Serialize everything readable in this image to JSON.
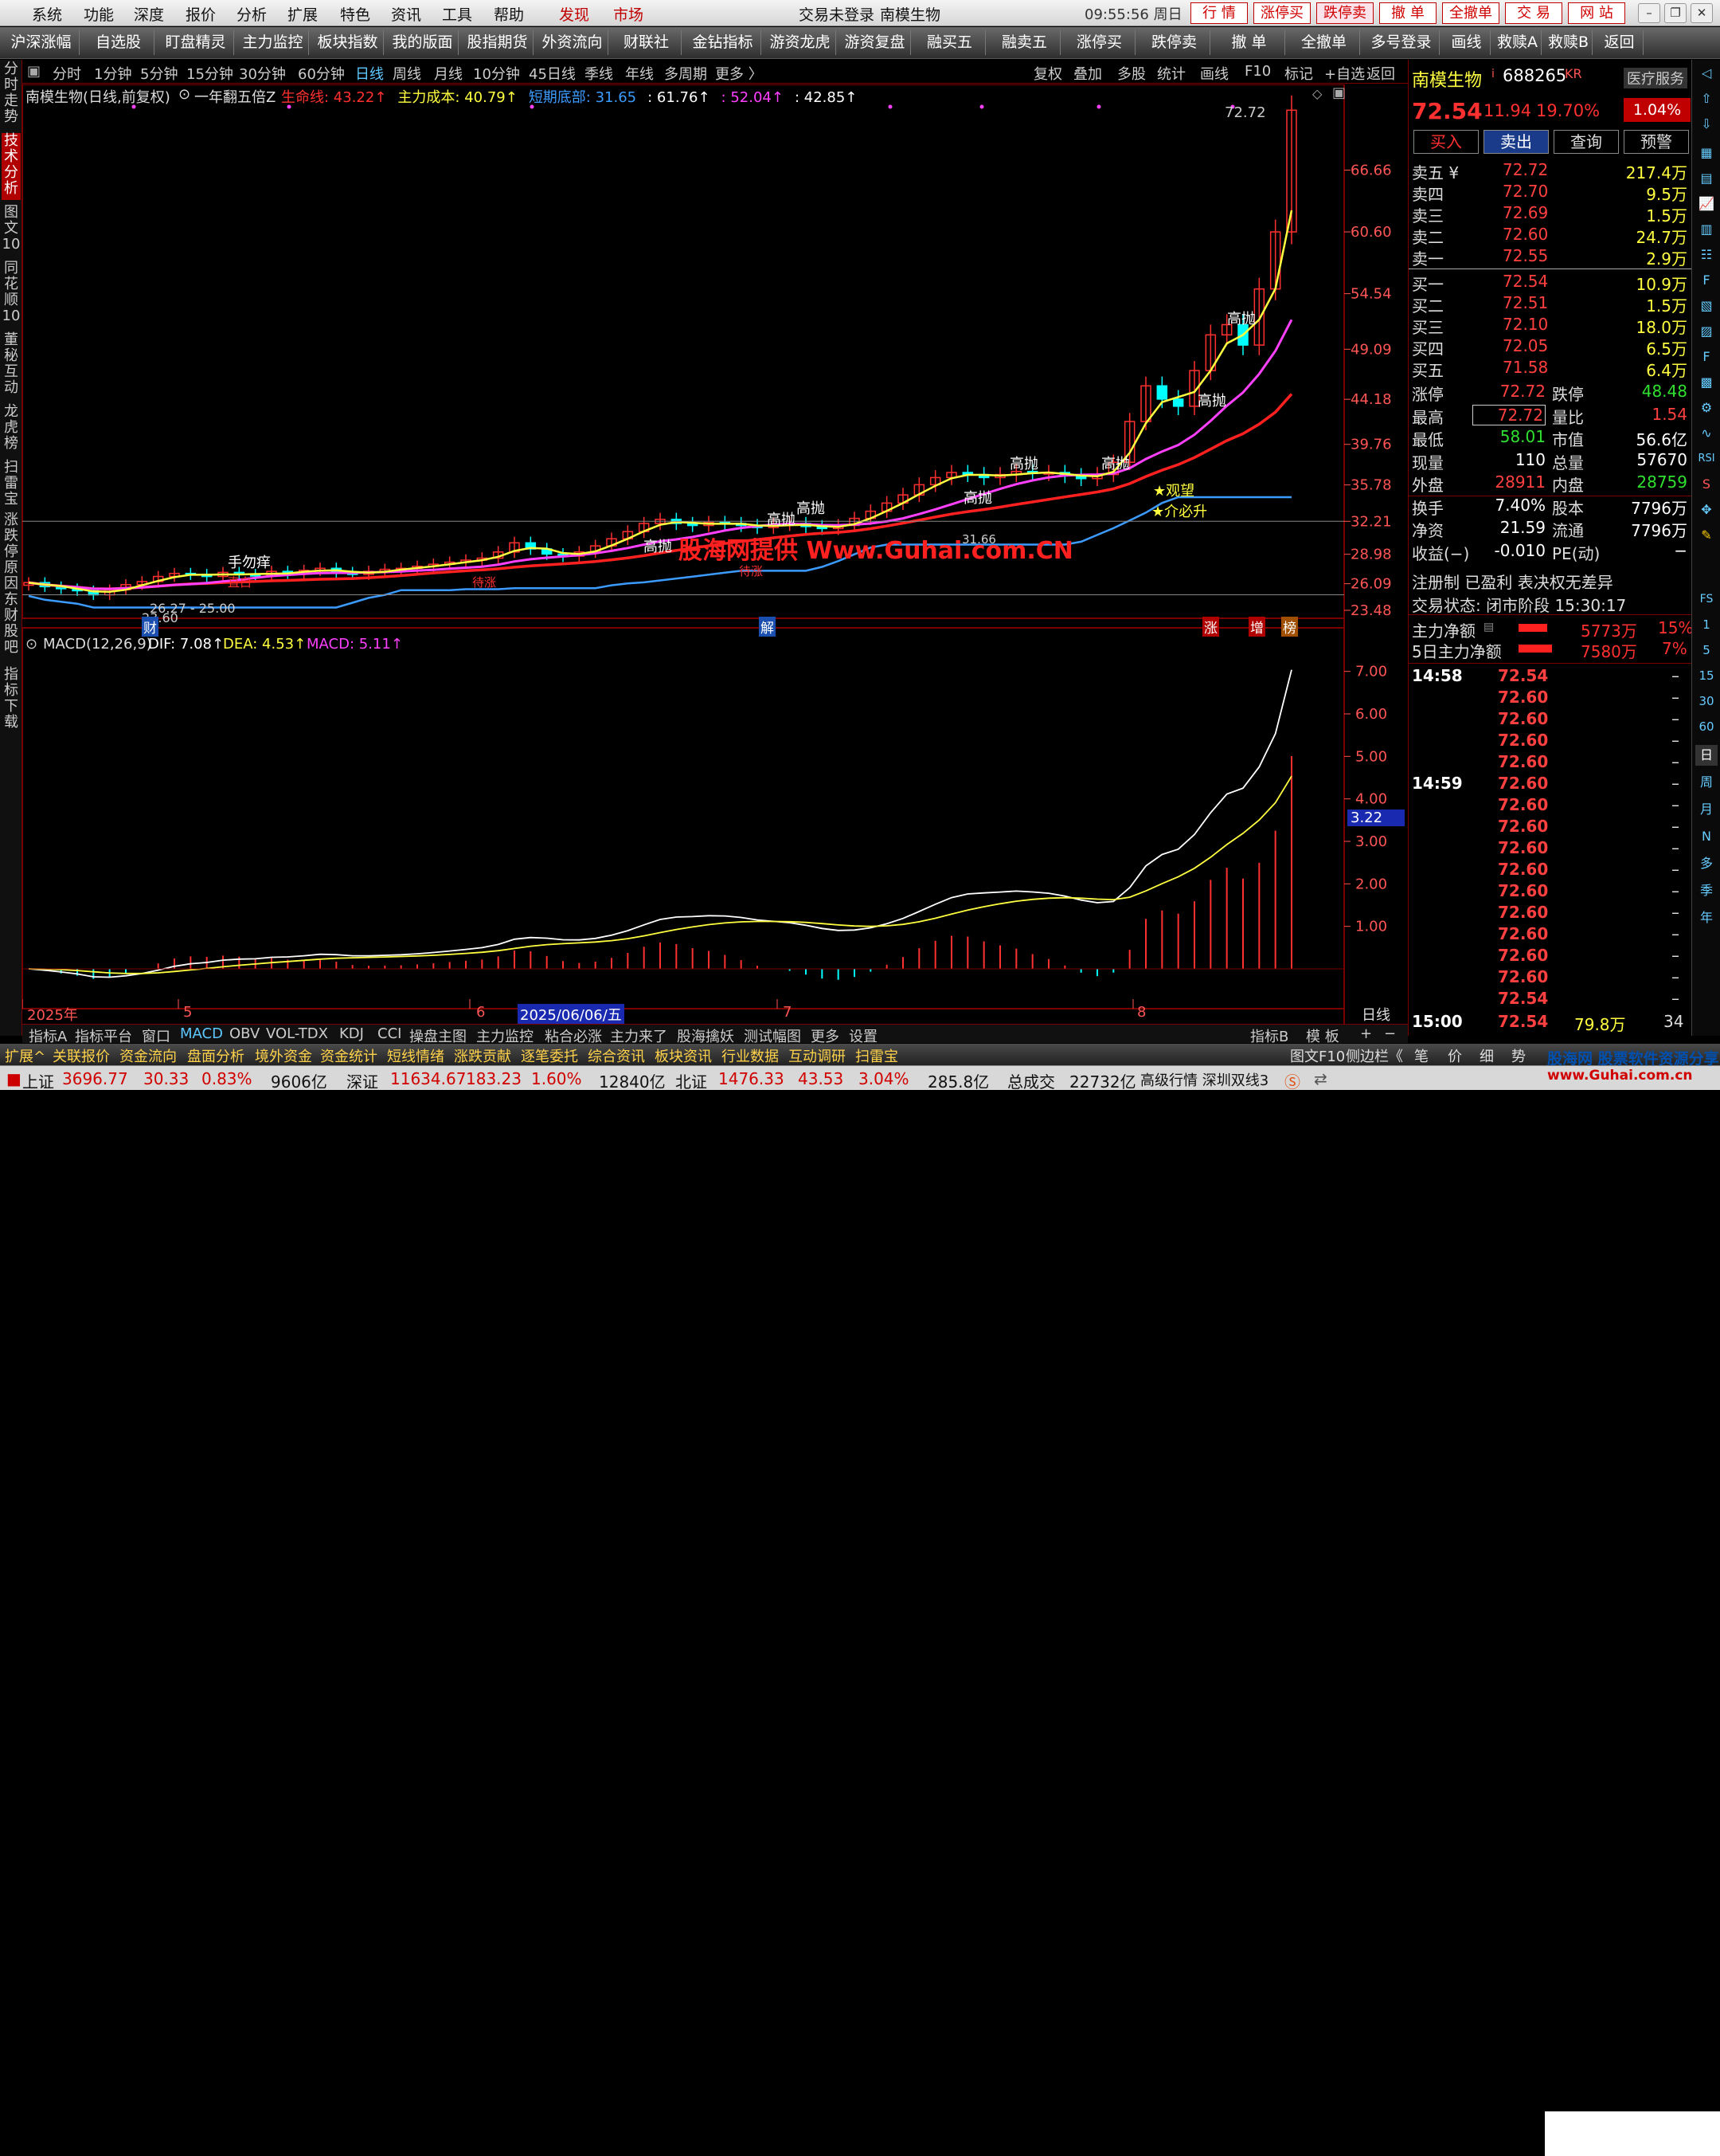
{
  "menubar": {
    "items": [
      "系统",
      "功能",
      "深度",
      "报价",
      "分析",
      "扩展",
      "特色",
      "资讯",
      "工具",
      "帮助"
    ],
    "discover": "发现",
    "market": "市场",
    "login_status": "交易未登录",
    "stock_name": "南模生物",
    "clock": "09:55:56 周日",
    "right_buttons": [
      "行 情",
      "涨停买",
      "跌停卖",
      "撤 单",
      "全撤单",
      "交 易",
      "网 站"
    ]
  },
  "toolbar": {
    "items": [
      "沪深涨幅",
      "自选股",
      "盯盘精灵",
      "主力监控",
      "板块指数",
      "我的版面",
      "股指期货",
      "外资流向",
      "财联社",
      "金钻指标",
      "游资龙虎",
      "游资复盘",
      "融买五",
      "融卖五",
      "涨停买",
      "跌停卖",
      "撤 单",
      "全撤单",
      "多号登录",
      "画线",
      "救赎A",
      "救赎B",
      "返回"
    ]
  },
  "leftnav": {
    "items": [
      {
        "label": "分时走势",
        "active": false
      },
      {
        "label": "技术分析",
        "active": true
      },
      {
        "label": "图文10",
        "active": false
      },
      {
        "label": "同花顺10",
        "active": false
      },
      {
        "label": "董秘互动",
        "active": false
      },
      {
        "label": "龙虎榜",
        "active": false
      },
      {
        "label": "扫雷宝",
        "active": false
      },
      {
        "label": "涨跌停原因",
        "active": false
      },
      {
        "label": "东财股吧",
        "active": false
      },
      {
        "label": "指标下载",
        "active": false
      }
    ]
  },
  "periods": {
    "items": [
      "分时",
      "1分钟",
      "5分钟",
      "15分钟",
      "30分钟",
      "60分钟",
      "日线",
      "周线",
      "月线",
      "10分钟",
      "45日线",
      "季线",
      "年线",
      "多周期",
      "更多 〉"
    ],
    "active": "日线",
    "right": [
      "复权",
      "叠加",
      "多股",
      "统计",
      "画线",
      "F10",
      "标记",
      "+自选",
      "返回"
    ]
  },
  "main_chart": {
    "title": "南模生物(日线,前复权)",
    "indicator": "一年翻五倍Z",
    "legend": [
      {
        "text": "生命线: 43.22↑",
        "color": "#ff3030"
      },
      {
        "text": "主力成本: 40.79↑",
        "color": "#ffff40"
      },
      {
        "text": "短期底部: 31.65",
        "color": "#3c9bff"
      },
      {
        "text": ": 61.76↑",
        "color": "#ffffff"
      },
      {
        "text": ": 52.04↑",
        "color": "#ff40ff"
      },
      {
        "text": ": 42.85↑",
        "color": "#ffffff"
      }
    ],
    "y_ticks": [
      "66.66",
      "60.60",
      "54.54",
      "49.09",
      "44.18",
      "39.76",
      "35.78",
      "32.21",
      "28.98",
      "26.09",
      "23.48"
    ],
    "annotations": {
      "peak": "72.72",
      "low": "23.60",
      "low_range": "26.27 - 25.00",
      "mid": "31.66",
      "high_sell": "高抛",
      "no_scratch": "手勿痒",
      "watch": "★观望",
      "must_rise": "★介必升",
      "bottom": "直白",
      "bottom2": "待涨",
      "bottom3": "待涨"
    },
    "markers": {
      "cai": "财",
      "jie": "解",
      "zhang": "涨",
      "zeng": "增",
      "bang": "榜"
    },
    "watermark": "股海网提供 Www.Guhai.com.CN"
  },
  "macd": {
    "title": "MACD(12,26,9)",
    "dif": "DIF: 7.08↑",
    "dea": "DEA: 4.53↑",
    "macd": "MACD: 5.11↑",
    "y_ticks": [
      "7.00",
      "6.00",
      "5.00",
      "4.00",
      "3.00",
      "2.00",
      "1.00"
    ],
    "current": "3.22",
    "x_labels": [
      "2025年",
      "5",
      "6",
      "2025/06/06/五",
      "7",
      "8"
    ],
    "period_label": "日线"
  },
  "bottom_tabs": {
    "items": [
      "指标A",
      "指标平台",
      "窗口",
      "MACD",
      "OBV",
      "VOL-TDX",
      "KDJ",
      "CCI",
      "操盘主图",
      "主力监控",
      "粘合必涨",
      "主力来了",
      "股海擒妖",
      "测试幅图",
      "更多",
      "设置"
    ],
    "active": "MACD",
    "right": [
      "指标B",
      "模 板",
      "+",
      "−"
    ]
  },
  "ext_bar": {
    "items": [
      "扩展^",
      "关联报价",
      "资金流向",
      "盘面分析",
      "境外资金",
      "资金统计",
      "短线情绪",
      "涨跌贡献",
      "逐笔委托",
      "综合资讯",
      "板块资讯",
      "行业数据",
      "互动调研",
      "扫雷宝"
    ],
    "right": [
      "图文F10",
      "侧边栏《",
      "笔",
      "价",
      "细",
      "势"
    ]
  },
  "status": {
    "sh_label": "上证",
    "sh_value": "3696.77",
    "sh_change": "30.33",
    "sh_pct": "0.83%",
    "sh_amount": "9606亿",
    "sz_label": "深证",
    "sz_value": "11634.67",
    "sz_change": "183.23",
    "sz_pct": "1.60%",
    "sz_amount": "12840亿",
    "nb_label": "北证",
    "nb_value": "1476.33",
    "nb_change": "43.53",
    "nb_pct": "3.04%",
    "nb_amount": "285.8亿",
    "total_label": "总成交",
    "total_value": "22732亿",
    "feed": "高级行情 深圳双线3",
    "brand": "股海网 股票软件资源分享",
    "brand_url": "www.Guhai.com.cn"
  },
  "quote": {
    "name": "南模生物",
    "code": "688265",
    "kr": "KR",
    "sector": "医疗服务",
    "price": "72.54",
    "change": "11.94",
    "pct": "19.70%",
    "sector_pct": "1.04%",
    "buttons": [
      "买入",
      "卖出",
      "查询",
      "预警"
    ],
    "sells": [
      {
        "label": "卖五 ¥",
        "price": "72.72",
        "vol": "217.4万"
      },
      {
        "label": "卖四",
        "price": "72.70",
        "vol": "9.5万"
      },
      {
        "label": "卖三",
        "price": "72.69",
        "vol": "1.5万"
      },
      {
        "label": "卖二",
        "price": "72.60",
        "vol": "24.7万"
      },
      {
        "label": "卖一",
        "price": "72.55",
        "vol": "2.9万"
      }
    ],
    "buys": [
      {
        "label": "买一",
        "price": "72.54",
        "vol": "10.9万"
      },
      {
        "label": "买二",
        "price": "72.51",
        "vol": "1.5万"
      },
      {
        "label": "买三",
        "price": "72.10",
        "vol": "18.0万"
      },
      {
        "label": "买四",
        "price": "72.05",
        "vol": "6.5万"
      },
      {
        "label": "买五",
        "price": "71.58",
        "vol": "6.4万"
      }
    ],
    "stats": [
      {
        "l1": "涨停",
        "v1": "72.72",
        "c1": "q-red",
        "l2": "跌停",
        "v2": "48.48",
        "c2": "q-grn"
      },
      {
        "l1": "最高",
        "v1": "72.72",
        "c1": "q-red",
        "l2": "量比",
        "v2": "1.54",
        "c2": "q-red"
      },
      {
        "l1": "最低",
        "v1": "58.01",
        "c1": "q-grn",
        "l2": "市值",
        "v2": "56.6亿",
        "c2": "q-white"
      },
      {
        "l1": "现量",
        "v1": "110",
        "c1": "q-white",
        "l2": "总量",
        "v2": "57670",
        "c2": "q-white"
      },
      {
        "l1": "外盘",
        "v1": "28911",
        "c1": "q-red",
        "l2": "内盘",
        "v2": "28759",
        "c2": "q-grn"
      },
      {
        "l1": "换手",
        "v1": "7.40%",
        "c1": "q-white",
        "l2": "股本",
        "v2": "7796万",
        "c2": "q-white"
      },
      {
        "l1": "净资",
        "v1": "21.59",
        "c1": "q-white",
        "l2": "流通",
        "v2": "7796万",
        "c2": "q-white"
      },
      {
        "l1": "收益(−)",
        "v1": "-0.010",
        "c1": "q-white",
        "l2": "PE(动)",
        "v2": "−",
        "c2": "q-white"
      }
    ],
    "reg": "注册制 已盈利 表决权无差异",
    "trade_state": "交易状态: 闭市阶段 15:30:17",
    "fund1": {
      "label": "主力净额",
      "value": "5773万",
      "pct": "15%"
    },
    "fund2": {
      "label": "5日主力净额",
      "value": "7580万",
      "pct": "7%"
    },
    "ticks": [
      {
        "t": "14:58",
        "p": "72.54"
      },
      {
        "t": "",
        "p": "72.60"
      },
      {
        "t": "",
        "p": "72.60"
      },
      {
        "t": "",
        "p": "72.60"
      },
      {
        "t": "",
        "p": "72.60"
      },
      {
        "t": "14:59",
        "p": "72.60"
      },
      {
        "t": "",
        "p": "72.60"
      },
      {
        "t": "",
        "p": "72.60"
      },
      {
        "t": "",
        "p": "72.60"
      },
      {
        "t": "",
        "p": "72.60"
      },
      {
        "t": "",
        "p": "72.60"
      },
      {
        "t": "",
        "p": "72.60"
      },
      {
        "t": "",
        "p": "72.60"
      },
      {
        "t": "",
        "p": "72.60"
      },
      {
        "t": "",
        "p": "72.60"
      },
      {
        "t": "",
        "p": "72.54"
      }
    ],
    "last_tick": {
      "t": "15:00",
      "p": "72.54",
      "v": "79.8万",
      "n": "34"
    }
  },
  "sidebar": {
    "labels": [
      "RSI",
      "S",
      "FS",
      "1",
      "5",
      "15",
      "30",
      "60",
      "日",
      "周",
      "月",
      "N",
      "多",
      "季",
      "年"
    ]
  },
  "colors": {
    "up": "#ff3030",
    "down": "#00ffff",
    "yellow": "#ffff40",
    "magenta": "#ff40ff",
    "blue": "#3c9bff",
    "white": "#ffffff",
    "red_line": "#ff2020"
  },
  "chart_data": {
    "type": "line",
    "price": {
      "ylim": [
        23.48,
        72.72
      ],
      "close": [
        26.2,
        25.8,
        25.6,
        25.4,
        25.0,
        25.5,
        26.0,
        26.3,
        26.8,
        27.1,
        27.0,
        26.8,
        27.2,
        27.0,
        26.9,
        27.3,
        27.1,
        27.4,
        27.6,
        27.2,
        27.0,
        27.3,
        27.5,
        27.6,
        27.8,
        28.0,
        28.2,
        28.4,
        28.6,
        29.2,
        30.1,
        29.5,
        29.0,
        28.8,
        29.2,
        29.8,
        30.5,
        31.2,
        32.0,
        32.4,
        32.0,
        31.8,
        32.1,
        32.0,
        31.8,
        31.6,
        31.9,
        32.0,
        31.7,
        31.5,
        31.8,
        32.5,
        33.2,
        34.0,
        34.8,
        35.8,
        36.5,
        37.0,
        36.8,
        36.5,
        36.8,
        37.1,
        36.9,
        37.0,
        36.7,
        36.4,
        36.8,
        38.0,
        42.0,
        45.5,
        44.2,
        43.5,
        47.0,
        50.5,
        51.5,
        49.5,
        55.0,
        60.6,
        72.54
      ]
    }
  }
}
